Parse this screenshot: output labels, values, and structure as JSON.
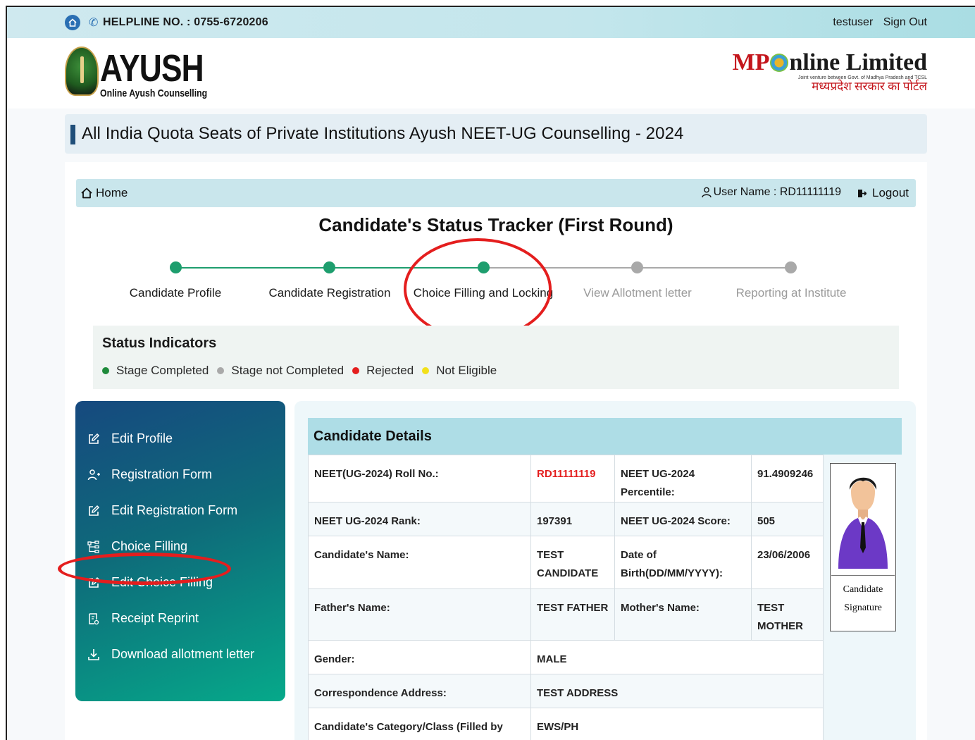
{
  "topbar": {
    "helpline": "HELPLINE NO. : 0755-6720206",
    "username": "testuser",
    "signout": "Sign Out"
  },
  "header": {
    "ayush_title": "AYUSH",
    "ayush_subtitle": "Online Ayush Counselling",
    "mp_logo": {
      "mp": "MP",
      "nline": "nline",
      "limited": "Limited",
      "tagline": "Joint venture between Govt. of Madhya Pradesh and TCSL",
      "hindi": "मध्यप्रदेश सरकार का पोर्टल"
    }
  },
  "page_title": "All India Quota Seats of Private Institutions Ayush NEET-UG Counselling - 2024",
  "nav": {
    "home": "Home",
    "user_name": "User Name : RD11111119",
    "logout": "Logout"
  },
  "tracker": {
    "title": "Candidate's Status Tracker (First Round)",
    "steps": [
      {
        "label": "Candidate Profile",
        "status": "completed"
      },
      {
        "label": "Candidate Registration",
        "status": "completed"
      },
      {
        "label": "Choice Filling and Locking",
        "status": "completed"
      },
      {
        "label": "View Allotment letter",
        "status": "not_completed"
      },
      {
        "label": "Reporting at Institute",
        "status": "not_completed"
      }
    ]
  },
  "status_indicators": {
    "title": "Status Indicators",
    "items": [
      {
        "label": "Stage Completed",
        "color": "#1e8a3a"
      },
      {
        "label": "Stage not Completed",
        "color": "#a9a9a9"
      },
      {
        "label": "Rejected",
        "color": "#e41e1e"
      },
      {
        "label": "Not Eligible",
        "color": "#f2e01a"
      }
    ]
  },
  "sidebar": {
    "items": [
      {
        "label": "Edit Profile",
        "icon": "edit-icon"
      },
      {
        "label": "Registration Form",
        "icon": "user-add-icon"
      },
      {
        "label": "Edit Registration Form",
        "icon": "edit-icon"
      },
      {
        "label": "Choice Filling",
        "icon": "choice-tree-icon"
      },
      {
        "label": "Edit Choice Filling",
        "icon": "edit-icon"
      },
      {
        "label": "Receipt Reprint",
        "icon": "receipt-icon"
      },
      {
        "label": "Download allotment letter",
        "icon": "download-icon"
      }
    ]
  },
  "details": {
    "title": "Candidate Details",
    "roll_label": "NEET(UG-2024) Roll No.:",
    "roll_value": "RD11111119",
    "percentile_label": "NEET UG-2024 Percentile:",
    "percentile_value": "91.4909246",
    "rank_label": "NEET UG-2024 Rank:",
    "rank_value": "197391",
    "score_label": "NEET UG-2024 Score:",
    "score_value": "505",
    "name_label": "Candidate's Name:",
    "name_value": "TEST CANDIDATE",
    "dob_label": "Date of Birth(DD/MM/YYYY):",
    "dob_value": "23/06/2006",
    "father_label": "Father's Name:",
    "father_value": "TEST FATHER",
    "mother_label": "Mother's Name:",
    "mother_value": "TEST MOTHER",
    "gender_label": "Gender:",
    "gender_value": "MALE",
    "address_label": "Correspondence Address:",
    "address_value": "TEST ADDRESS",
    "category_label": "Candidate's Category/Class (Filled by Candidate):",
    "category_value": "EWS/PH",
    "signature_label": "Candidate Signature"
  },
  "colors": {
    "accent_done": "#1e9e6e",
    "pending": "#a9a9a9",
    "annotation": "#e41e1e"
  }
}
